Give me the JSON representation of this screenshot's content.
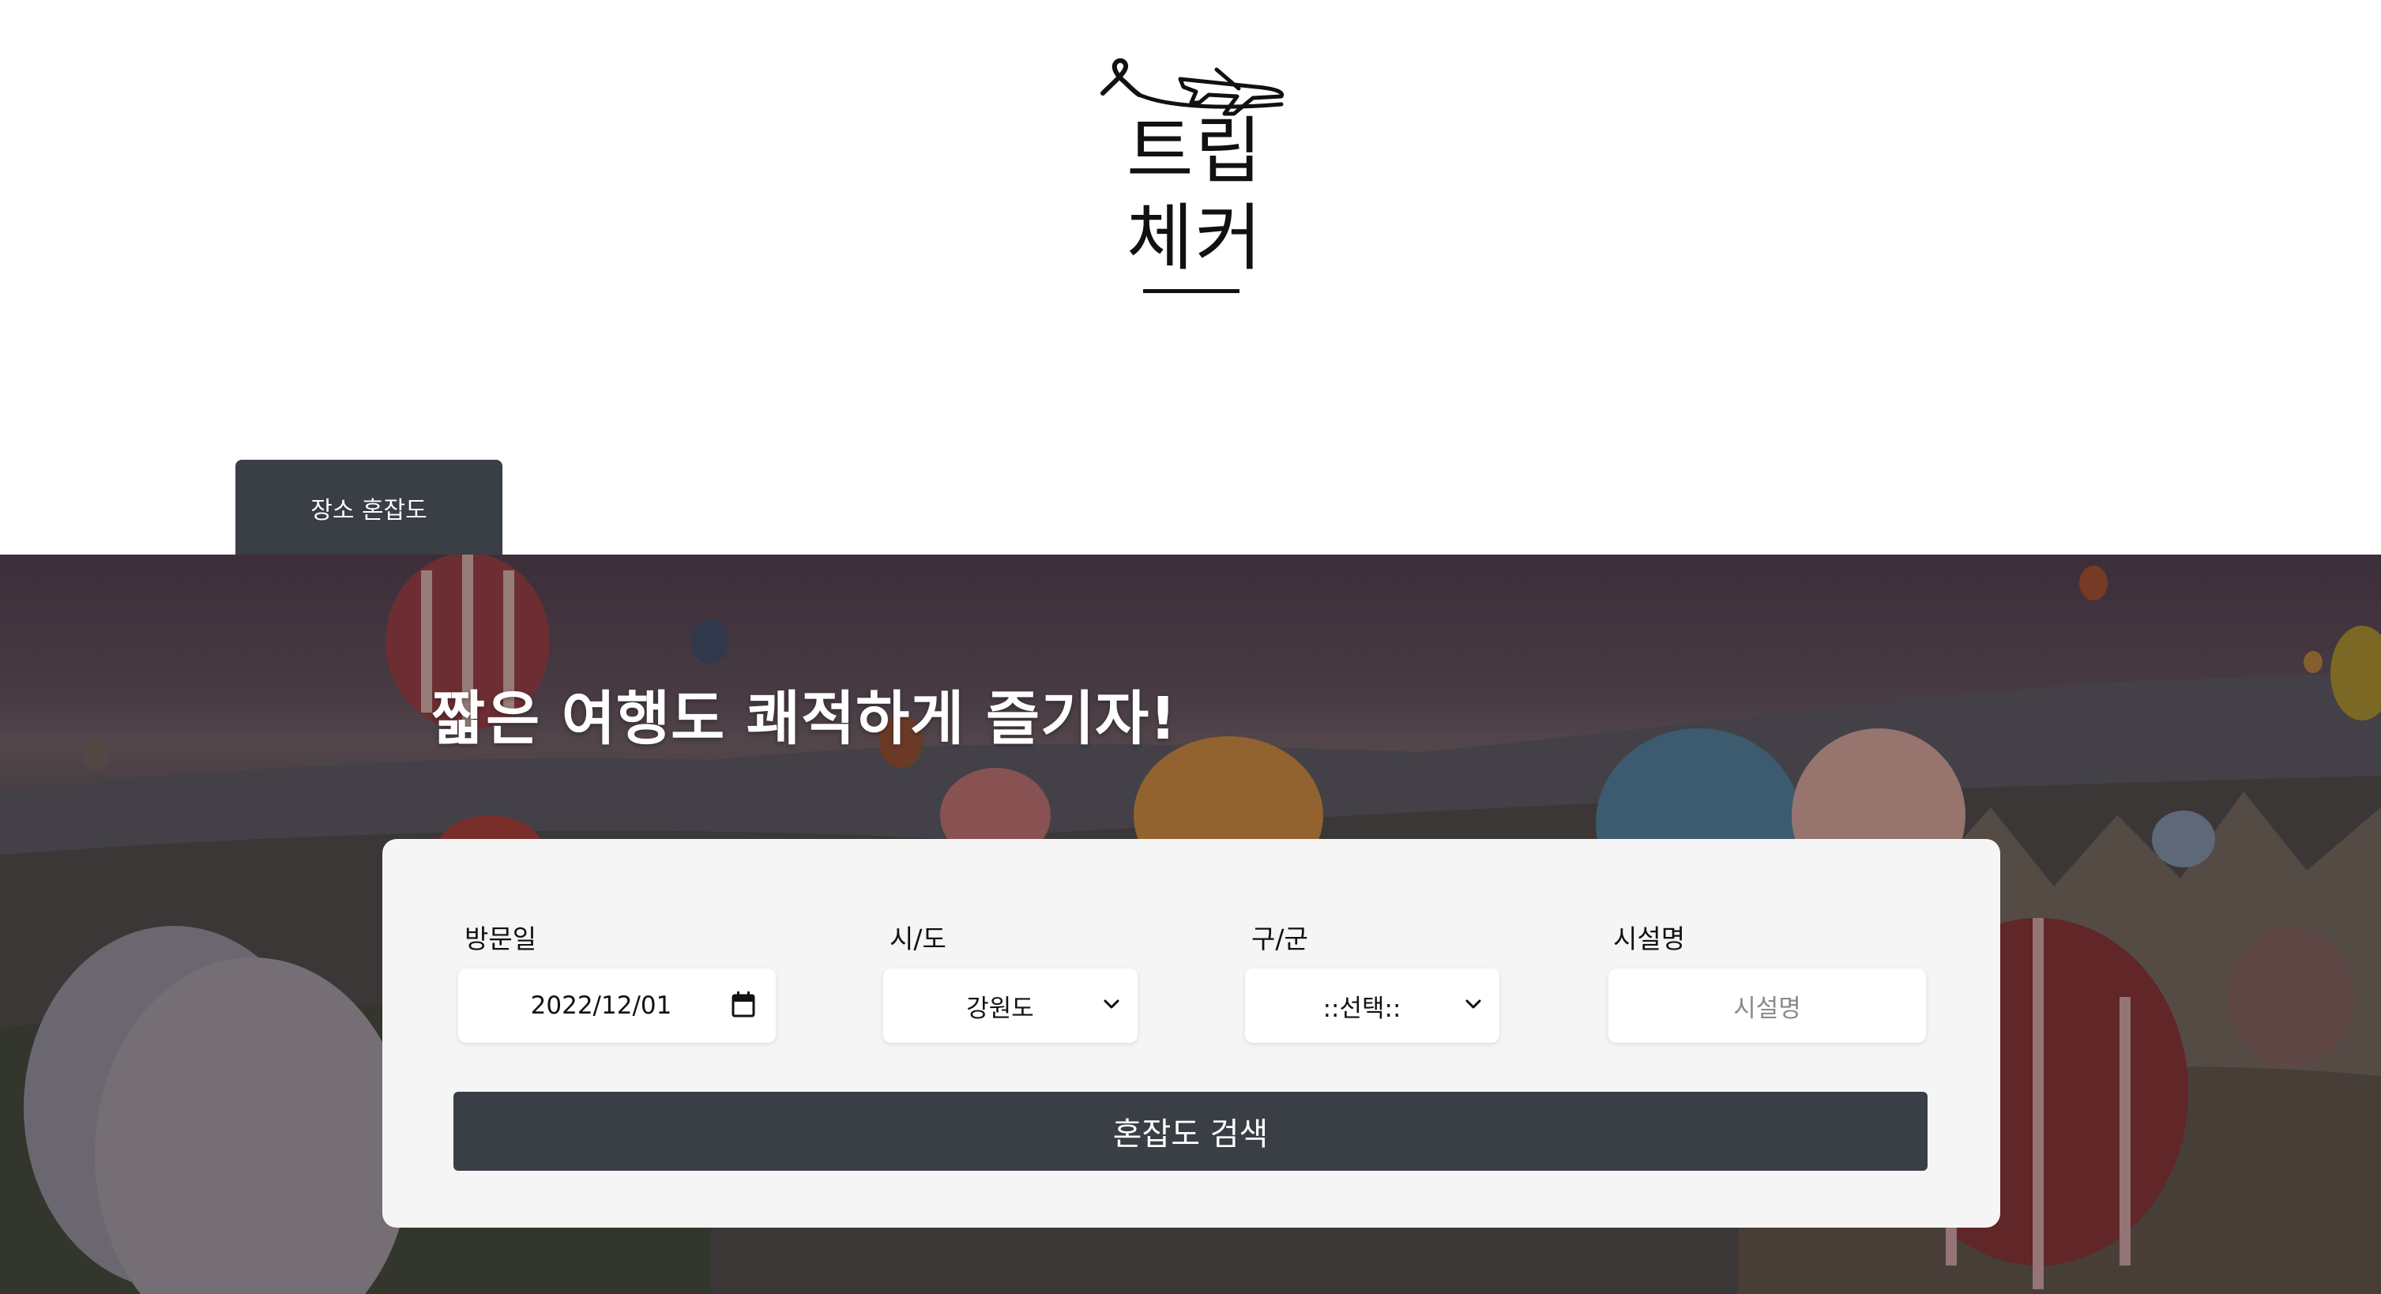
{
  "logo": {
    "line1": "트립",
    "line2": "체커"
  },
  "tabs": [
    {
      "label": "장소 혼잡도",
      "active": true
    }
  ],
  "hero": {
    "headline": "짧은 여행도 쾌적하게 즐기자!"
  },
  "search": {
    "visit_date": {
      "label": "방문일",
      "value": "2022/12/01"
    },
    "province": {
      "label": "시/도",
      "selected": "강원도"
    },
    "district": {
      "label": "구/군",
      "selected": "::선택::"
    },
    "facility": {
      "label": "시설명",
      "placeholder": "시설명"
    },
    "submit_label": "혼잡도 검색"
  },
  "colors": {
    "dark_button": "#3a3e45",
    "panel": "#f5f5f5",
    "page": "#ffffff"
  },
  "icons": {
    "logo": "airplane-icon",
    "date": "calendar-icon",
    "select": "chevron-down-icon"
  }
}
